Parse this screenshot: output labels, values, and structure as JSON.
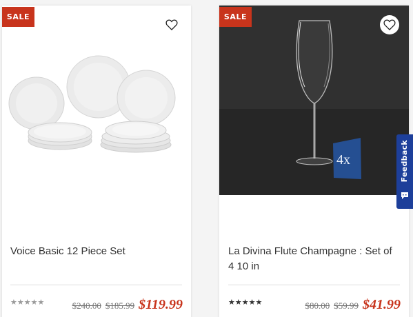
{
  "products": [
    {
      "badge": "SALE",
      "title": "Voice Basic 12 Piece Set",
      "rating_stars": "★★★★★",
      "rating_value": 0,
      "price_original": "$240.00",
      "price_previous": "$185.99",
      "price_sale": "$119.99",
      "wishlist_icon": "heart-outline-icon"
    },
    {
      "badge": "SALE",
      "title": "La Divina Flute Champagne : Set of 4 10 in",
      "rating_stars": "★★★★★",
      "rating_value": 5,
      "price_original": "$80.00",
      "price_previous": "$59.99",
      "price_sale": "$41.99",
      "wishlist_icon": "heart-outline-icon",
      "image_text": "4x"
    }
  ],
  "feedback": {
    "label": "Feedback",
    "icon": "chat-icon",
    "color": "#1d3f9a"
  },
  "colors": {
    "sale": "#c8341c",
    "accent_price": "#c8341c"
  }
}
